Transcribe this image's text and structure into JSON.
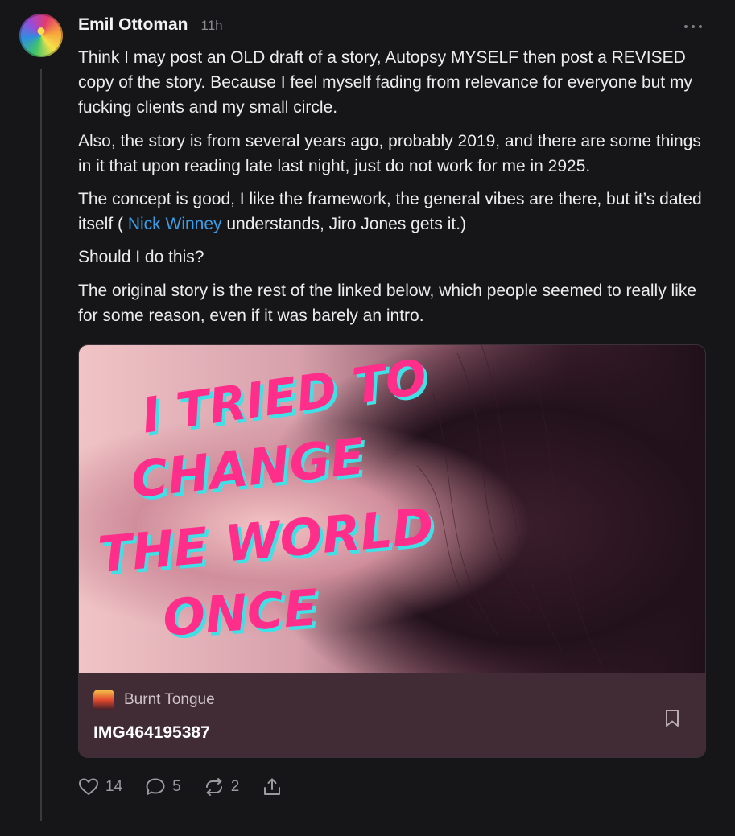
{
  "post": {
    "author": "Emil Ottoman",
    "time": "11h",
    "paragraphs": {
      "p1": "Think I may post an OLD draft of a story, Autopsy MYSELF then post a REVISED copy of the story. Because I feel myself fading from relevance for everyone but my fucking clients and my small circle.",
      "p2": "Also, the story is from several years ago, probably 2019, and there are some things in it that upon reading late last night, just do not work for me in 2925.",
      "p3_before": "The concept is good, I like the framework, the general vibes are there, but it’s dated itself ( ",
      "p3_mention": "Nick Winney",
      "p3_after": " understands, Jiro Jones gets it.)",
      "p4": "Should I do this?",
      "p5": "The original story is the rest of the linked below, which people seemed to really like for some reason, even if it was barely an intro."
    }
  },
  "card": {
    "image_text": [
      "I TRIED TO",
      "CHANGE",
      "THE WORLD",
      "ONCE"
    ],
    "source": "Burnt Tongue",
    "title": "IMG464195387"
  },
  "actions": {
    "likes": "14",
    "comments": "5",
    "restacks": "2"
  },
  "icons": {
    "menu": "more-horizontal-icon",
    "like": "heart-icon",
    "comment": "comment-bubble-icon",
    "restack": "restack-icon",
    "share": "share-icon",
    "bookmark": "bookmark-icon"
  },
  "colors": {
    "background": "#161618",
    "mention": "#3b9ee8",
    "card_footer": "#412b35",
    "title_pink": "#ff2e8a",
    "title_cyan": "#3fe0e6"
  }
}
